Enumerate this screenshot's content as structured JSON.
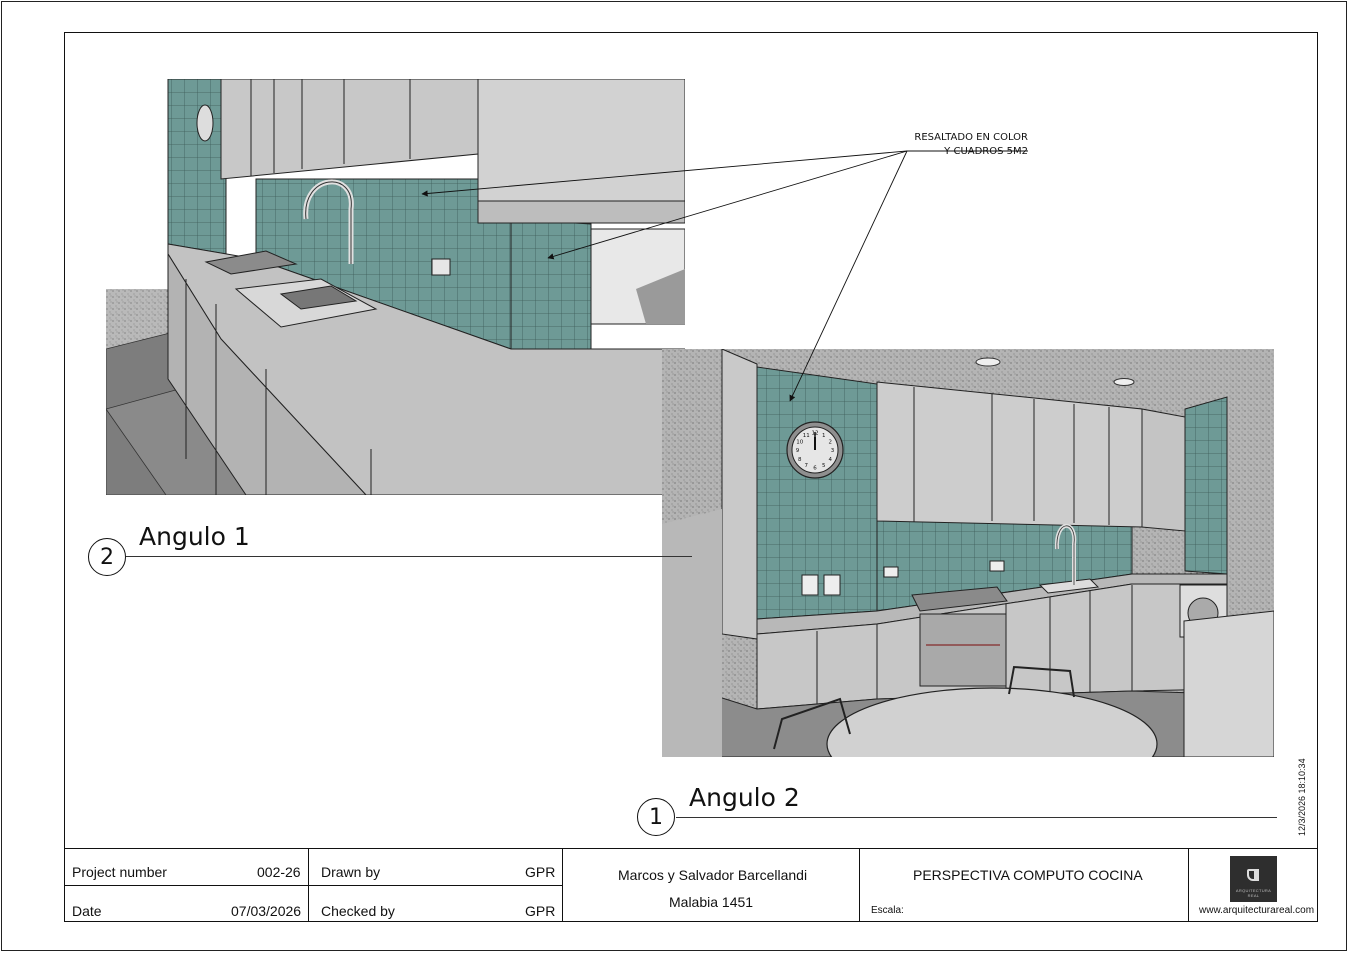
{
  "sheet": {
    "callout_line1": "RESALTADO EN COLOR",
    "callout_line2": "Y CUADROS 5M2",
    "view1": {
      "number": "2",
      "title": "Angulo 1"
    },
    "view2": {
      "number": "1",
      "title": "Angulo 2"
    },
    "timestamp": "12/3/2026 18:10:34"
  },
  "clock_numbers": [
    "12",
    "1",
    "2",
    "3",
    "4",
    "5",
    "6",
    "7",
    "8",
    "9",
    "10",
    "11"
  ],
  "title_block": {
    "project_number_label": "Project number",
    "project_number_value": "002-26",
    "date_label": "Date",
    "date_value": "07/03/2026",
    "drawn_by_label": "Drawn by",
    "drawn_by_value": "GPR",
    "checked_by_label": "Checked by",
    "checked_by_value": "GPR",
    "client": "Marcos y Salvador Barcellandi",
    "address": "Malabia 1451",
    "sheet_title": "PERSPECTIVA COMPUTO COCINA",
    "scale_label": "Escala:",
    "website": "www.arquitecturareal.com",
    "logo_text": "ARQUITECTURA REAL"
  },
  "colors": {
    "tile": "#6e9a96",
    "grout": "#3c5b58",
    "surface": "#c9c9c9",
    "floor": "#8d8d8d",
    "line": "#111111"
  }
}
